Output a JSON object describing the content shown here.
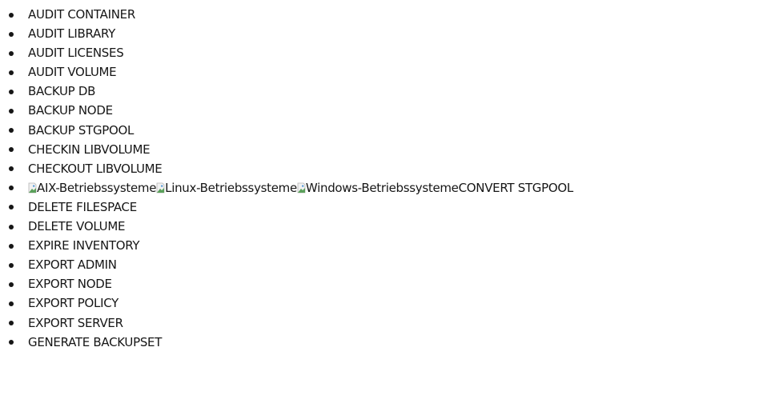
{
  "commands": [
    {
      "label": "AUDIT CONTAINER"
    },
    {
      "label": "AUDIT LIBRARY"
    },
    {
      "label": "AUDIT LICENSES"
    },
    {
      "label": "AUDIT VOLUME"
    },
    {
      "label": "BACKUP DB"
    },
    {
      "label": "BACKUP NODE"
    },
    {
      "label": "BACKUP STGPOOL"
    },
    {
      "label": "CHECKIN LIBVOLUME"
    },
    {
      "label": "CHECKOUT LIBVOLUME"
    },
    {
      "label": "CONVERT STGPOOL",
      "os_badges": [
        "AIX-Betriebssysteme",
        "Linux-Betriebssysteme",
        "Windows-Betriebssysteme"
      ],
      "badge_icon": "broken-image-icon"
    },
    {
      "label": "DELETE FILESPACE"
    },
    {
      "label": "DELETE VOLUME"
    },
    {
      "label": "EXPIRE INVENTORY"
    },
    {
      "label": "EXPORT ADMIN"
    },
    {
      "label": "EXPORT NODE"
    },
    {
      "label": "EXPORT POLICY"
    },
    {
      "label": "EXPORT SERVER"
    },
    {
      "label": "GENERATE BACKUPSET"
    }
  ],
  "colors": {
    "text": "#161616",
    "background": "#ffffff"
  }
}
